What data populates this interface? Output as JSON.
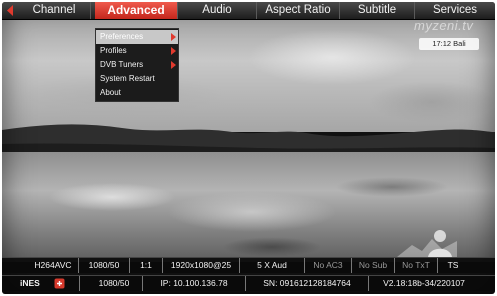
{
  "menu": {
    "items": [
      {
        "label": "Channel"
      },
      {
        "label": "Advanced"
      },
      {
        "label": "Audio"
      },
      {
        "label": "Aspect Ratio"
      },
      {
        "label": "Subtitle"
      },
      {
        "label": "Services"
      }
    ],
    "active": "Advanced"
  },
  "dropdown": {
    "items": [
      {
        "label": "Preferences",
        "submenu": true,
        "selected": true
      },
      {
        "label": "Profiles",
        "submenu": true
      },
      {
        "label": "DVB Tuners",
        "submenu": true
      },
      {
        "label": "System Restart"
      },
      {
        "label": "About"
      }
    ]
  },
  "overlay": {
    "logo_text": "myzeni.tv",
    "channel_badge": "17:12 Bali"
  },
  "status_bar": {
    "row1": [
      "H264AVC",
      "1080/50",
      "1:1",
      "1920x1080@25",
      "5 X Aud",
      "No AC3",
      "No Sub",
      "No TxT",
      "TS"
    ],
    "row2": {
      "brand": "iNES",
      "resolution": "1080/50",
      "ip": "IP: 10.100.136.78",
      "serial": "SN: 091612128184764",
      "version": "V2.18:18b-34/220107"
    }
  },
  "colors": {
    "accent_red": "#d6392c",
    "bar_bg": "#1d1d1d",
    "dim_text": "#9a9a9a"
  }
}
